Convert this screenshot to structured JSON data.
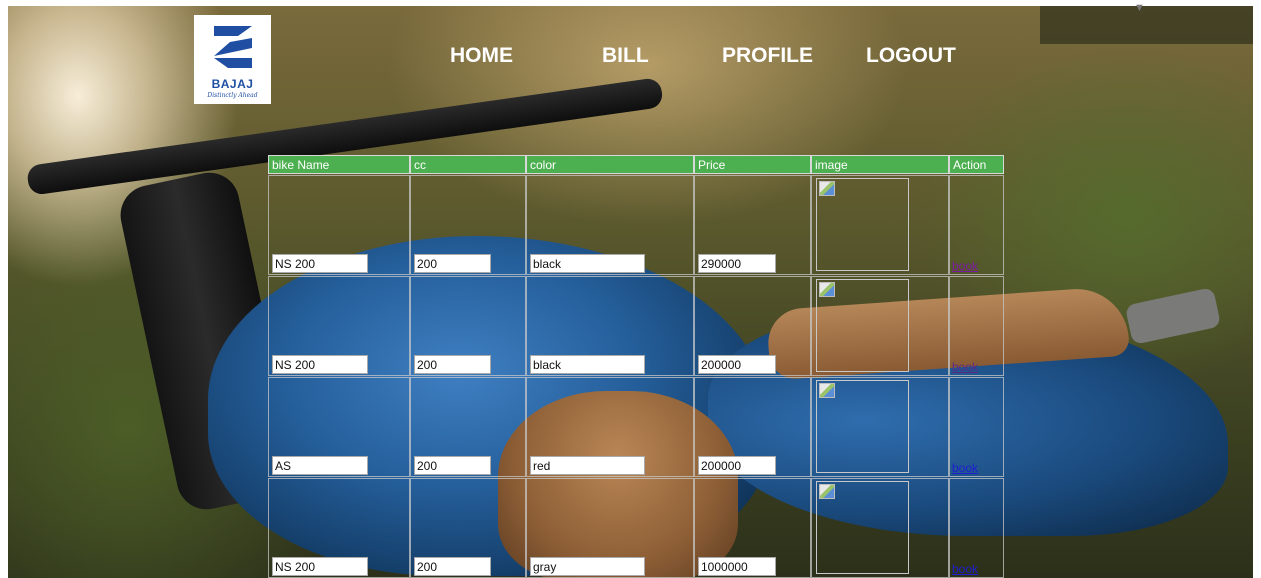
{
  "logo": {
    "brand": "BAJAJ",
    "tagline": "Distinctly Ahead",
    "icon": "bajaj-logo-icon",
    "brand_color": "#1f4ea3"
  },
  "nav": {
    "items": [
      "HOME",
      "BILL",
      "PROFILE",
      "LOGOUT"
    ]
  },
  "table": {
    "header_color": "#4caf50",
    "columns": [
      "bike Name",
      "cc",
      "color",
      "Price",
      "image",
      "Action"
    ],
    "rows": [
      {
        "name": "NS 200",
        "cc": "200",
        "color": "black",
        "price": "290000",
        "action": "book"
      },
      {
        "name": "NS 200",
        "cc": "200",
        "color": "black",
        "price": "200000",
        "action": "book"
      },
      {
        "name": "AS",
        "cc": "200",
        "color": "red",
        "price": "200000",
        "action": "book"
      },
      {
        "name": "NS 200",
        "cc": "200",
        "color": "gray",
        "price": "1000000",
        "action": "book"
      }
    ]
  }
}
